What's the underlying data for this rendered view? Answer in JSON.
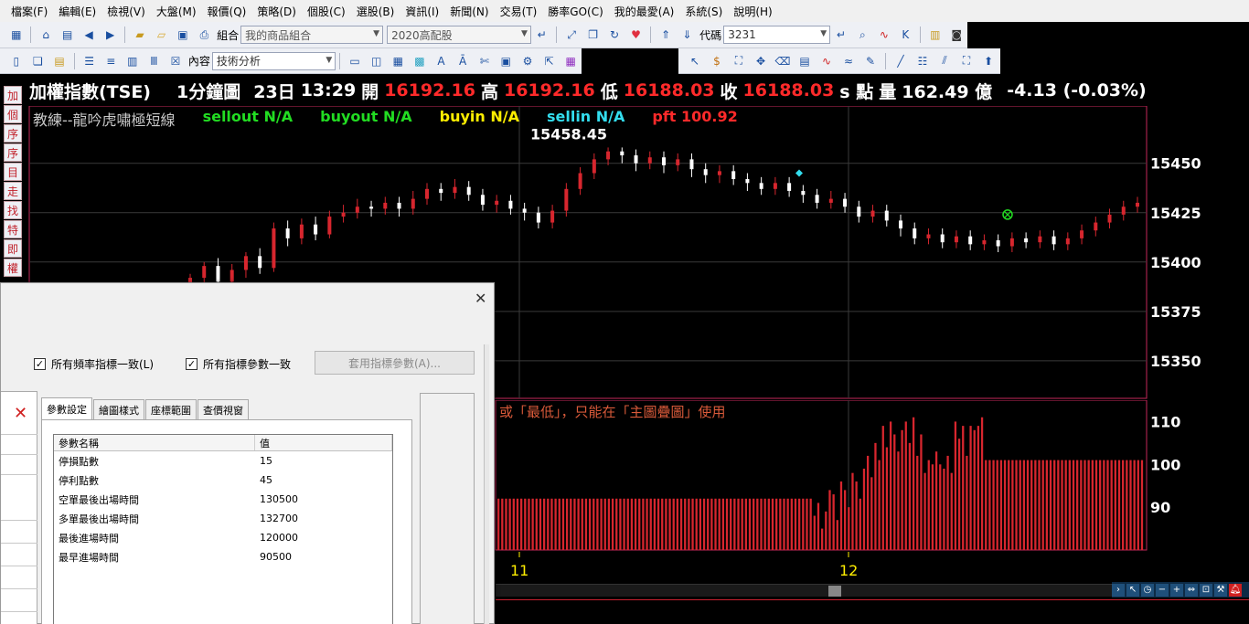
{
  "menu": [
    "檔案(F)",
    "編輯(E)",
    "檢視(V)",
    "大盤(M)",
    "報價(Q)",
    "策略(D)",
    "個股(C)",
    "選股(B)",
    "資訊(I)",
    "新聞(N)",
    "交易(T)",
    "勝率GO(C)",
    "我的最愛(A)",
    "系統(S)",
    "說明(H)"
  ],
  "toolbar1": {
    "group_label": "組合",
    "group_value": "我的商品組合",
    "dividend_value": "2020高配股",
    "code_label": "代碼",
    "code_value": "3231"
  },
  "toolbar2": {
    "content_label": "內容",
    "content_value": "技術分析"
  },
  "vtabs": [
    "加",
    "個",
    "序",
    "序",
    "目",
    "走",
    "找",
    "特",
    "即",
    "權"
  ],
  "header": {
    "name": "加權指數(TSE)",
    "period": "1分鐘圖",
    "day": "23日",
    "time": "13:29",
    "open_label": "開",
    "open_value": "16192.16",
    "high_label": "高",
    "high_value": "16192.16",
    "low_label": "低",
    "low_value": "16188.03",
    "close_label": "收",
    "close_value": "16188.03",
    "unit": "s 點",
    "volume_label": "量",
    "volume_value": "162.49 億",
    "change": "-4.13 (-0.03%)"
  },
  "indicator": {
    "strategy": "教練--龍吟虎嘯極短線",
    "sellout": "sellout N/A",
    "buyout": "buyout N/A",
    "buyin": "buyin N/A",
    "sellin": "sellin N/A",
    "pft": "pft 100.92"
  },
  "colors": {
    "up": "#d7262e",
    "down": "#ffffff",
    "grid": "#3a3a3a",
    "frame": "#c3275a",
    "green": "#22dd22",
    "yellow": "#ffee00",
    "cyan": "#33ddee"
  },
  "sub_caption": "或「最低」，只能在「主圖疊圖」使用",
  "chart_data": [
    {
      "type": "candlestick",
      "title": "",
      "peak_label": "15458.45",
      "y_ticks": [
        15450,
        15425,
        15400,
        15375,
        15350
      ],
      "ylim": [
        15331,
        15479
      ],
      "x_ticks": [
        "11",
        "12"
      ],
      "candles": [
        [
          15385,
          15392,
          15380,
          15394
        ],
        [
          15392,
          15398,
          15388,
          15400
        ],
        [
          15398,
          15390,
          15386,
          15402
        ],
        [
          15390,
          15396,
          15387,
          15399
        ],
        [
          15396,
          15403,
          15392,
          15405
        ],
        [
          15403,
          15397,
          15394,
          15407
        ],
        [
          15397,
          15417,
          15395,
          15420
        ],
        [
          15417,
          15412,
          15408,
          15421
        ],
        [
          15412,
          15419,
          15409,
          15422
        ],
        [
          15419,
          15414,
          15411,
          15423
        ],
        [
          15414,
          15423,
          15412,
          15426
        ],
        [
          15423,
          15425,
          15420,
          15429
        ],
        [
          15425,
          15428,
          15422,
          15432
        ],
        [
          15428,
          15427,
          15423,
          15431
        ],
        [
          15427,
          15430,
          15424,
          15433
        ],
        [
          15430,
          15427,
          15423,
          15433
        ],
        [
          15427,
          15432,
          15424,
          15436
        ],
        [
          15432,
          15437,
          15429,
          15440
        ],
        [
          15437,
          15435,
          15431,
          15440
        ],
        [
          15435,
          15438,
          15432,
          15442
        ],
        [
          15438,
          15434,
          15431,
          15441
        ],
        [
          15434,
          15429,
          15426,
          15437
        ],
        [
          15429,
          15431,
          15425,
          15434
        ],
        [
          15431,
          15427,
          15424,
          15434
        ],
        [
          15427,
          15425,
          15421,
          15430
        ],
        [
          15425,
          15420,
          15417,
          15428
        ],
        [
          15420,
          15426,
          15417,
          15429
        ],
        [
          15426,
          15437,
          15423,
          15440
        ],
        [
          15437,
          15445,
          15434,
          15448
        ],
        [
          15445,
          15452,
          15442,
          15455
        ],
        [
          15452,
          15456,
          15449,
          15458
        ],
        [
          15456,
          15454,
          15450,
          15458
        ],
        [
          15454,
          15450,
          15446,
          15457
        ],
        [
          15450,
          15453,
          15447,
          15456
        ],
        [
          15453,
          15449,
          15445,
          15456
        ],
        [
          15449,
          15452,
          15446,
          15455
        ],
        [
          15452,
          15447,
          15443,
          15455
        ],
        [
          15447,
          15444,
          15440,
          15450
        ],
        [
          15444,
          15446,
          15440,
          15449
        ],
        [
          15446,
          15442,
          15439,
          15449
        ],
        [
          15442,
          15440,
          15436,
          15445
        ],
        [
          15440,
          15437,
          15434,
          15443
        ],
        [
          15437,
          15440,
          15434,
          15443
        ],
        [
          15440,
          15436,
          15433,
          15443
        ],
        [
          15436,
          15434,
          15430,
          15439
        ],
        [
          15434,
          15430,
          15427,
          15437
        ],
        [
          15430,
          15432,
          15427,
          15436
        ],
        [
          15432,
          15428,
          15425,
          15435
        ],
        [
          15428,
          15423,
          15420,
          15431
        ],
        [
          15423,
          15426,
          15420,
          15429
        ],
        [
          15426,
          15421,
          15418,
          15429
        ],
        [
          15421,
          15417,
          15413,
          15424
        ],
        [
          15417,
          15412,
          15409,
          15420
        ],
        [
          15412,
          15414,
          15409,
          15417
        ],
        [
          15414,
          15410,
          15407,
          15417
        ],
        [
          15410,
          15413,
          15407,
          15416
        ],
        [
          15413,
          15409,
          15406,
          15416
        ],
        [
          15409,
          15411,
          15406,
          15414
        ],
        [
          15411,
          15408,
          15405,
          15414
        ],
        [
          15408,
          15412,
          15405,
          15415
        ],
        [
          15412,
          15410,
          15407,
          15415
        ],
        [
          15410,
          15413,
          15407,
          15416
        ],
        [
          15413,
          15409,
          15406,
          15416
        ],
        [
          15409,
          15412,
          15406,
          15415
        ],
        [
          15412,
          15416,
          15409,
          15419
        ],
        [
          15416,
          15420,
          15413,
          15423
        ],
        [
          15420,
          15424,
          15417,
          15427
        ],
        [
          15424,
          15428,
          15421,
          15431
        ],
        [
          15428,
          15430,
          15425,
          15433
        ]
      ],
      "markers": [
        {
          "type": "diamond",
          "value": 15445
        },
        {
          "type": "circle-x",
          "value": 15424
        }
      ]
    },
    {
      "type": "bar",
      "title": "",
      "y_ticks": [
        110,
        100,
        90
      ],
      "ylim": [
        80,
        115
      ],
      "values": [
        92,
        92,
        92,
        92,
        92,
        92,
        92,
        92,
        92,
        92,
        92,
        92,
        92,
        92,
        92,
        92,
        92,
        92,
        92,
        92,
        92,
        92,
        92,
        92,
        92,
        92,
        92,
        92,
        92,
        92,
        92,
        92,
        92,
        92,
        92,
        92,
        92,
        92,
        92,
        92,
        92,
        92,
        92,
        92,
        92,
        92,
        92,
        92,
        92,
        92,
        92,
        92,
        92,
        92,
        92,
        92,
        92,
        92,
        92,
        92,
        92,
        92,
        92,
        92,
        92,
        92,
        92,
        92,
        92,
        92,
        92,
        92,
        92,
        92,
        92,
        92,
        92,
        92,
        92,
        92,
        92,
        92,
        92,
        88,
        91,
        85,
        89,
        94,
        93,
        87,
        96,
        94,
        90,
        98,
        96,
        92,
        99,
        102,
        97,
        105,
        101,
        109,
        104,
        110,
        107,
        103,
        108,
        110,
        105,
        111,
        102,
        107,
        98,
        101,
        100,
        103,
        100,
        99,
        102,
        98,
        110,
        106,
        109,
        102,
        109,
        108,
        109,
        111,
        101,
        101,
        101,
        101,
        101,
        101,
        101,
        101,
        101,
        101,
        101,
        101,
        101,
        101,
        101,
        101,
        101,
        101,
        101,
        101,
        101,
        101,
        101,
        101,
        101,
        101,
        101,
        101,
        101,
        101,
        101,
        101,
        101,
        101,
        101,
        101,
        101,
        101,
        101,
        101,
        101,
        101
      ]
    }
  ],
  "dialog": {
    "check_freq": "所有頻率指標一致(L)",
    "check_param": "所有指標參數一致",
    "apply_button": "套用指標參數(A)...",
    "tabs": [
      "參數設定",
      "繪圖樣式",
      "座標範圍",
      "查價視窗"
    ],
    "table_headers": [
      "參數名稱",
      "值"
    ],
    "rows": [
      {
        "name": "停損點數",
        "value": "15"
      },
      {
        "name": "停利點數",
        "value": "45"
      },
      {
        "name": "空單最後出場時間",
        "value": "130500"
      },
      {
        "name": "多單最後出場時間",
        "value": "132700"
      },
      {
        "name": "最後進場時間",
        "value": "120000"
      },
      {
        "name": "最早進場時間",
        "value": "90500"
      }
    ]
  }
}
